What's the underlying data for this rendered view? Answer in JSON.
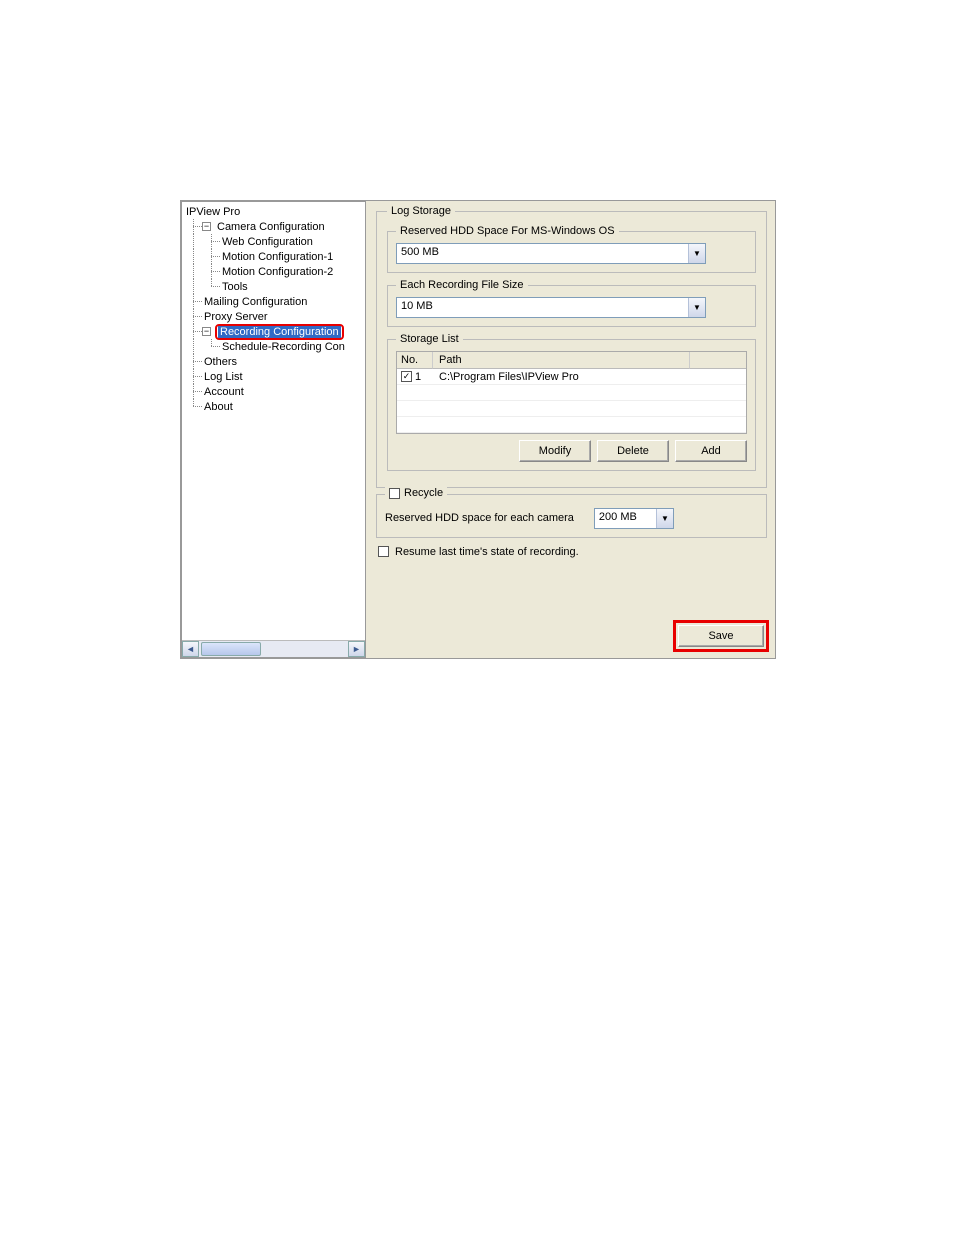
{
  "tree": {
    "root": "IPView Pro",
    "camera_config": "Camera Configuration",
    "web_config": "Web Configuration",
    "motion1": "Motion Configuration-1",
    "motion2": "Motion Configuration-2",
    "tools": "Tools",
    "mailing": "Mailing Configuration",
    "proxy": "Proxy Server",
    "recording": "Recording Configuration",
    "schedule": "Schedule-Recording Con",
    "others": "Others",
    "loglist": "Log List",
    "account": "Account",
    "about": "About"
  },
  "log_storage": {
    "legend": "Log Storage",
    "reserved": {
      "legend": "Reserved HDD Space For MS-Windows OS",
      "value": "500 MB"
    },
    "filesize": {
      "legend": "Each Recording File Size",
      "value": "10 MB"
    },
    "storage_list": {
      "legend": "Storage List",
      "col_no": "No.",
      "col_path": "Path",
      "row1_no": "1",
      "row1_path": "C:\\Program Files\\IPView Pro"
    },
    "buttons": {
      "modify": "Modify",
      "delete": "Delete",
      "add": "Add"
    }
  },
  "recycle": {
    "legend": "Recycle",
    "label": "Reserved HDD space for each camera",
    "value": "200 MB"
  },
  "resume_label": "Resume last time's state of recording.",
  "save_label": "Save"
}
